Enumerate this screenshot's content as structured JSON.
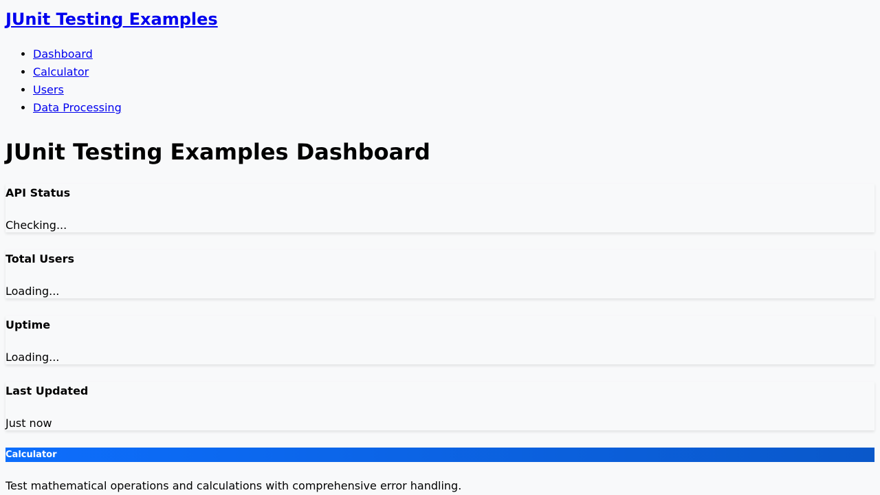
{
  "site": {
    "title": "JUnit Testing Examples"
  },
  "nav": {
    "items": [
      {
        "label": "Dashboard"
      },
      {
        "label": "Calculator"
      },
      {
        "label": "Users"
      },
      {
        "label": "Data Processing"
      }
    ]
  },
  "dashboard": {
    "title": "JUnit Testing Examples Dashboard",
    "cards": [
      {
        "title": "API Status",
        "value": "Checking..."
      },
      {
        "title": "Total Users",
        "value": "Loading..."
      },
      {
        "title": "Uptime",
        "value": "Loading..."
      },
      {
        "title": "Last Updated",
        "value": "Just now"
      }
    ]
  },
  "feature": {
    "title": "Calculator",
    "description": "Test mathematical operations and calculations with comprehensive error handling.",
    "header_color_start": "#0d6efd",
    "header_color_end": "#0a58ca"
  }
}
